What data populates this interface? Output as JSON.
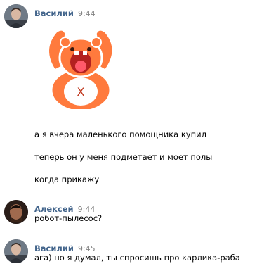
{
  "messages": [
    {
      "author": "Василий",
      "time": "9:44",
      "avatar_icon": "user-photo-vasily",
      "sticker": "orange-bear-sticker",
      "lines": [
        "а я вчера маленького помощника купил",
        "теперь он у меня подметает и моет полы",
        "когда прикажу"
      ]
    },
    {
      "author": "Алексей",
      "time": "9:44",
      "avatar_icon": "user-photo-alexey",
      "lines": [
        "робот-пылесос?"
      ]
    },
    {
      "author": "Василий",
      "time": "9:45",
      "avatar_icon": "user-photo-vasily",
      "lines": [
        "ага) но я думал, ты спросишь про карлика-раба"
      ]
    }
  ],
  "colors": {
    "author": "#42648b",
    "time": "#828282",
    "sticker_body": "#ff7a3d",
    "sticker_mouth": "#b3211f"
  }
}
